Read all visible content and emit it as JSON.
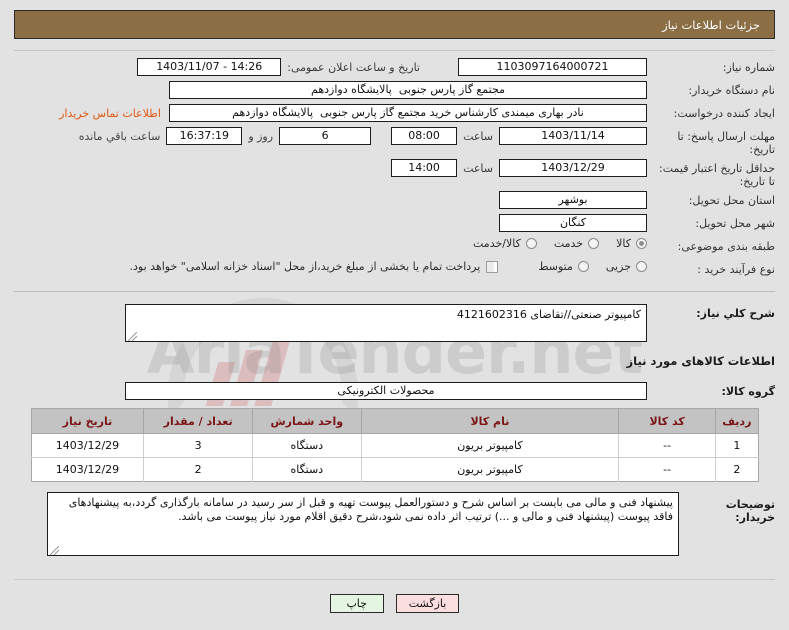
{
  "header": {
    "title": "جزئیات اطلاعات نیاز",
    "bg_color": "#8c6e44"
  },
  "form": {
    "need_number": {
      "label": "شماره نیاز:",
      "value": "1103097164000721"
    },
    "public_announce": {
      "label": "تاریخ و ساعت اعلان عمومی:",
      "value": "14:26 - 1403/11/07"
    },
    "buyer_org": {
      "label": "نام دستگاه خریدار:",
      "value": "مجتمع گاز پارس جنوبی  پالایشگاه دوازدهم"
    },
    "requester": {
      "label": "ایجاد کننده درخواست:",
      "value": "نادر بهاری میمندی کارشناس خرید مجتمع گاز پارس جنوبی  پالایشگاه دوازدهم"
    },
    "contact_link": "اطلاعات تماس خریدار",
    "reply_deadline": {
      "label": "مهلت ارسال پاسخ: تا تاریخ:",
      "date": "1403/11/14",
      "time_label": "ساعت",
      "time": "08:00",
      "days": "6",
      "days_label": "روز و",
      "remaining": "16:37:19",
      "remaining_label": "ساعت باقي مانده"
    },
    "price_validity": {
      "label": "حداقل تاریخ اعتبار قیمت: تا تاریخ:",
      "date": "1403/12/29",
      "time_label": "ساعت",
      "time": "14:00"
    },
    "delivery_province": {
      "label": "استان محل تحویل:",
      "value": "بوشهر"
    },
    "delivery_city": {
      "label": "شهر محل تحویل:",
      "value": "کنگان"
    },
    "subject_class": {
      "label": "طبقه بندی موضوعی:",
      "options": [
        "کالا",
        "خدمت",
        "کالا/خدمت"
      ],
      "selected": "کالا"
    },
    "purchase_process": {
      "label": "نوع فرآیند خرید :",
      "options": [
        "جزیی",
        "متوسط"
      ],
      "selected": null
    },
    "treasury_checkbox": {
      "label": "پرداخت تمام یا بخشی از مبلغ خرید،از محل \"اسناد خزانه اسلامی\" خواهد بود.",
      "checked": false
    }
  },
  "description": {
    "need_summary": {
      "label": "شرح کلي نیاز:",
      "value": "کامپیوتر صنعتی//تقاضای 4121602316"
    },
    "goods_section_title": "اطلاعات کالاهای مورد نیاز",
    "goods_group": {
      "label": "گروه کالا:",
      "value": "محصولات الکترونیکی"
    }
  },
  "items_table": {
    "columns": [
      "ردیف",
      "کد کالا",
      "نام کالا",
      "واحد شمارش",
      "تعداد / مقدار",
      "تاریخ نیاز"
    ],
    "rows": [
      {
        "row": "1",
        "code": "--",
        "name": "کامپیوتر بریون",
        "unit": "دستگاه",
        "qty": "3",
        "date": "1403/12/29"
      },
      {
        "row": "2",
        "code": "--",
        "name": "کامپیوتر بریون",
        "unit": "دستگاه",
        "qty": "2",
        "date": "1403/12/29"
      }
    ]
  },
  "buyer_notes": {
    "label": "توضیحات خریدار:",
    "value": "پیشنهاد فنی و مالی می بایست بر اساس شرح و دستورالعمل پیوست تهیه و قبل از سر رسید در سامانه بارگذاری گردد،به پیشنهادهای فاقد پیوست (پیشنهاد فنی و مالی و ...) ترتیب اثر داده نمی شود،شرح دقیق اقلام مورد نیاز پیوست می باشد."
  },
  "buttons": {
    "print": "چاپ",
    "back": "بازگشت"
  },
  "watermark": {
    "text": "AriaTender.net"
  }
}
